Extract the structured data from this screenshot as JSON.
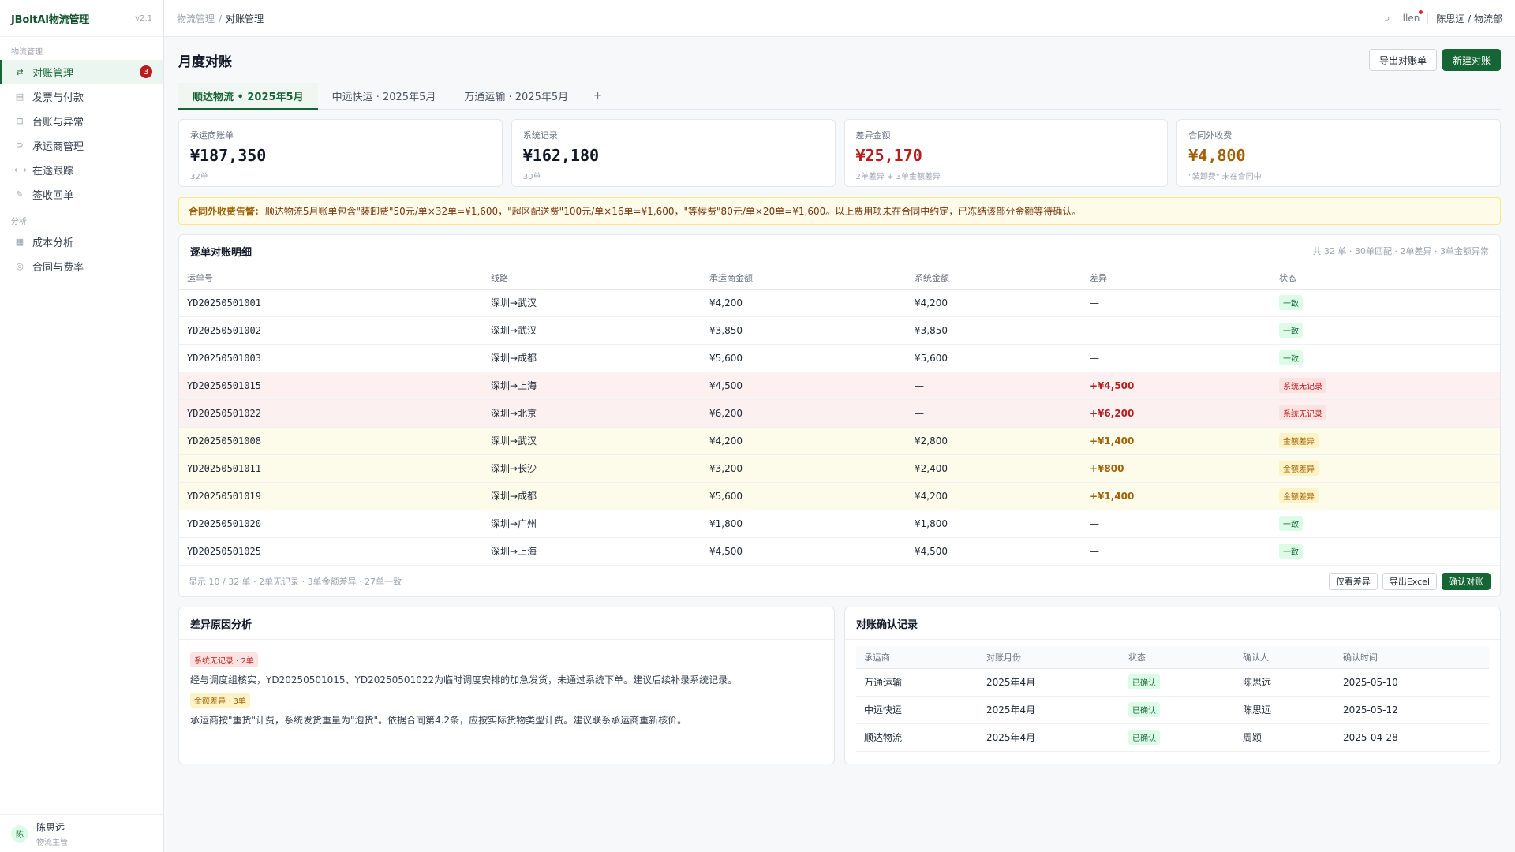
{
  "app": {
    "name": "JBoltAI物流管理",
    "version": "v2.1"
  },
  "sidebar": {
    "sections": [
      {
        "title": "物流管理",
        "items": [
          {
            "label": "对账管理",
            "icon": "swap-icon",
            "glyph": "⇄",
            "badge": "3",
            "active": true
          },
          {
            "label": "发票与付款",
            "icon": "invoice-icon",
            "glyph": "▤"
          },
          {
            "label": "台账与异常",
            "icon": "ledger-icon",
            "glyph": "⊟"
          },
          {
            "label": "承运商管理",
            "icon": "carrier-icon",
            "glyph": "⊇"
          },
          {
            "label": "在途跟踪",
            "icon": "transit-icon",
            "glyph": "⟷"
          },
          {
            "label": "签收回单",
            "icon": "sign-icon",
            "glyph": "✎"
          }
        ]
      },
      {
        "title": "分析",
        "items": [
          {
            "label": "成本分析",
            "icon": "chart-icon",
            "glyph": "▦"
          },
          {
            "label": "合同与费率",
            "icon": "contract-icon",
            "glyph": "◎"
          }
        ]
      }
    ],
    "user": {
      "avatar": "陈",
      "name": "陈思远",
      "role": "物流主管"
    }
  },
  "topbar": {
    "breadcrumb": [
      "物流管理",
      "对账管理"
    ],
    "sep": "/",
    "search_glyph": "⌕",
    "bell_text": "llen",
    "user": "陈思远 / 物流部"
  },
  "page": {
    "title": "月度对账",
    "export_label": "导出对账单",
    "new_label": "新建对账"
  },
  "tabs": [
    {
      "label": "顺达物流 • 2025年5月",
      "active": true
    },
    {
      "label": "中远快运 · 2025年5月"
    },
    {
      "label": "万通运输 · 2025年5月"
    },
    {
      "label": "+",
      "add": true
    }
  ],
  "stats": [
    {
      "label": "承运商账单",
      "value": "¥187,350",
      "sub": "32单",
      "tone": ""
    },
    {
      "label": "系统记录",
      "value": "¥162,180",
      "sub": "30单",
      "tone": ""
    },
    {
      "label": "差异金额",
      "value": "¥25,170",
      "sub": "2单差异 + 3单金额差异",
      "tone": "red"
    },
    {
      "label": "合同外收费",
      "value": "¥4,800",
      "sub": "\"装卸费\" 未在合同中",
      "tone": "amber"
    }
  ],
  "alert": {
    "title": "合同外收费告警:",
    "text": "顺达物流5月账单包含\"装卸费\"50元/单×32单=¥1,600，\"超区配送费\"100元/单×16单=¥1,600，\"等候费\"80元/单×20单=¥1,600。以上费用项未在合同中约定，已冻结该部分金额等待确认。"
  },
  "detail": {
    "title": "逐单对账明细",
    "meta": "共 32 单 · 30单匹配 · 2单差异 · 3单金额异常",
    "columns": [
      "运单号",
      "线路",
      "承运商金额",
      "系统金额",
      "差异",
      "状态"
    ],
    "rows": [
      {
        "id": "YD20250501001",
        "route": "深圳→武汉",
        "carrier": "¥4,200",
        "system": "¥4,200",
        "diff": "—",
        "status": "一致",
        "kind": "ok"
      },
      {
        "id": "YD20250501002",
        "route": "深圳→武汉",
        "carrier": "¥3,850",
        "system": "¥3,850",
        "diff": "—",
        "status": "一致",
        "kind": "ok"
      },
      {
        "id": "YD20250501003",
        "route": "深圳→成都",
        "carrier": "¥5,600",
        "system": "¥5,600",
        "diff": "—",
        "status": "一致",
        "kind": "ok"
      },
      {
        "id": "YD20250501015",
        "route": "深圳→上海",
        "carrier": "¥4,500",
        "system": "—",
        "diff": "+¥4,500",
        "status": "系统无记录",
        "kind": "miss"
      },
      {
        "id": "YD20250501022",
        "route": "深圳→北京",
        "carrier": "¥6,200",
        "system": "—",
        "diff": "+¥6,200",
        "status": "系统无记录",
        "kind": "miss"
      },
      {
        "id": "YD20250501008",
        "route": "深圳→武汉",
        "carrier": "¥4,200",
        "system": "¥2,800",
        "diff": "+¥1,400",
        "status": "金额差异",
        "kind": "diff"
      },
      {
        "id": "YD20250501011",
        "route": "深圳→长沙",
        "carrier": "¥3,200",
        "system": "¥2,400",
        "diff": "+¥800",
        "status": "金额差异",
        "kind": "diff"
      },
      {
        "id": "YD20250501019",
        "route": "深圳→成都",
        "carrier": "¥5,600",
        "system": "¥4,200",
        "diff": "+¥1,400",
        "status": "金额差异",
        "kind": "diff"
      },
      {
        "id": "YD20250501020",
        "route": "深圳→广州",
        "carrier": "¥1,800",
        "system": "¥1,800",
        "diff": "—",
        "status": "一致",
        "kind": "ok"
      },
      {
        "id": "YD20250501025",
        "route": "深圳→上海",
        "carrier": "¥4,500",
        "system": "¥4,500",
        "diff": "—",
        "status": "一致",
        "kind": "ok"
      }
    ],
    "footer": "显示 10 / 32 单 · 2单无记录 · 3单金额差异 · 27单一致",
    "only_diff_label": "仅看差异",
    "export_excel_label": "导出Excel",
    "confirm_label": "确认对账"
  },
  "analysis": {
    "title": "差异原因分析",
    "items": [
      {
        "tag": "系统无记录 · 2单",
        "kind": "miss",
        "text": "经与调度组核实，YD20250501015、YD20250501022为临时调度安排的加急发货，未通过系统下单。建议后续补录系统记录。"
      },
      {
        "tag": "金额差异 · 3单",
        "kind": "diff",
        "text": "承运商按\"重货\"计费，系统发货重量为\"泡货\"。依据合同第4.2条，应按实际货物类型计费。建议联系承运商重新核价。"
      }
    ]
  },
  "records": {
    "title": "对账确认记录",
    "columns": [
      "承运商",
      "对账月份",
      "状态",
      "确认人",
      "确认时间"
    ],
    "rows": [
      {
        "carrier": "万通运输",
        "month": "2025年4月",
        "status": "已确认",
        "by": "陈思远",
        "time": "2025-05-10"
      },
      {
        "carrier": "中远快运",
        "month": "2025年4月",
        "status": "已确认",
        "by": "陈思远",
        "time": "2025-05-12"
      },
      {
        "carrier": "顺达物流",
        "month": "2025年4月",
        "status": "已确认",
        "by": "周颖",
        "time": "2025-04-28"
      }
    ]
  }
}
